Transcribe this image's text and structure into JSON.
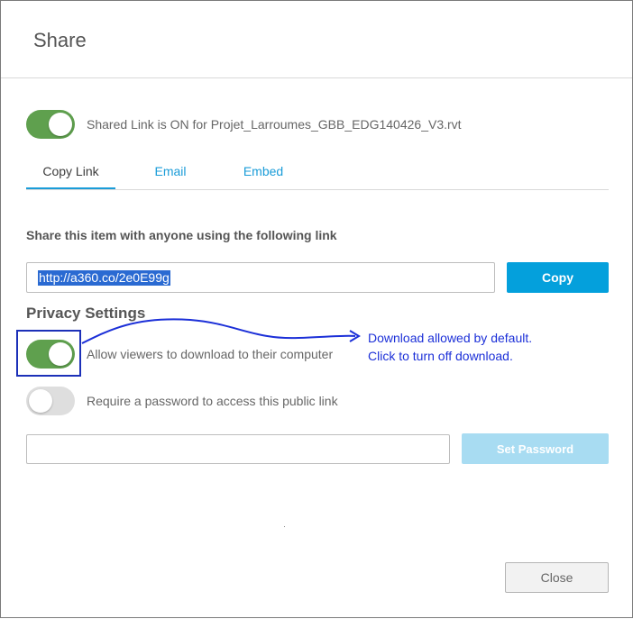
{
  "dialog": {
    "title": "Share"
  },
  "shared_link": {
    "enabled": true,
    "label": "Shared Link is ON for Projet_Larroumes_GBB_EDG140426_V3.rvt"
  },
  "tabs": [
    {
      "label": "Copy Link",
      "active": true
    },
    {
      "label": "Email",
      "active": false
    },
    {
      "label": "Embed",
      "active": false
    }
  ],
  "copy_link": {
    "heading": "Share this item with anyone using the following link",
    "url_value": "http://a360.co/2e0E99g",
    "copy_button": "Copy"
  },
  "privacy": {
    "heading": "Privacy Settings",
    "download": {
      "enabled": true,
      "label": "Allow viewers to download to their computer"
    },
    "password": {
      "enabled": false,
      "label": "Require a password to access this public link",
      "input_value": "",
      "set_button": "Set Password"
    }
  },
  "annotation": {
    "line1": "Download allowed by default.",
    "line2": "Click to turn off download."
  },
  "footer": {
    "close_button": "Close"
  },
  "colors": {
    "toggle_on": "#5fa04e",
    "toggle_off": "#dedede",
    "accent": "#04a0dc",
    "annotation": "#1c30d8"
  }
}
